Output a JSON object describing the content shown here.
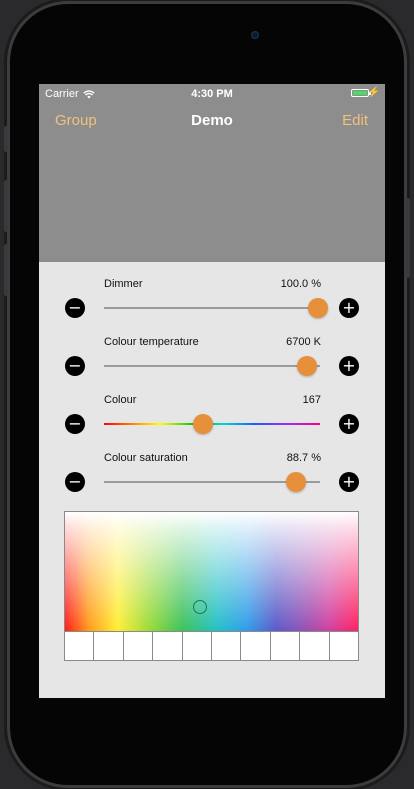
{
  "status_bar": {
    "carrier": "Carrier",
    "time": "4:30 PM",
    "battery_level": 1.0
  },
  "nav": {
    "left": "Group",
    "title": "Demo",
    "right": "Edit"
  },
  "controls": [
    {
      "label": "Dimmer",
      "value_text": "100.0 %",
      "level": 0.99
    },
    {
      "label": "Colour temperature",
      "value_text": "6700 K",
      "level": 0.94
    },
    {
      "label": "Colour",
      "value_text": "167",
      "level": 0.46
    },
    {
      "label": "Colour saturation",
      "value_text": "88.7 %",
      "level": 0.887
    }
  ],
  "colors": {
    "accent": "#f0c27a",
    "thumb": "#e6903b",
    "nav_bg": "#8d8d8d",
    "content_bg": "#e6e6e6"
  },
  "icons": {
    "minus": "minus-circle-icon",
    "plus": "plus-circle-icon",
    "wifi": "wifi-icon",
    "battery": "battery-icon",
    "charging": "bolt-icon"
  },
  "swatch_count": 10
}
